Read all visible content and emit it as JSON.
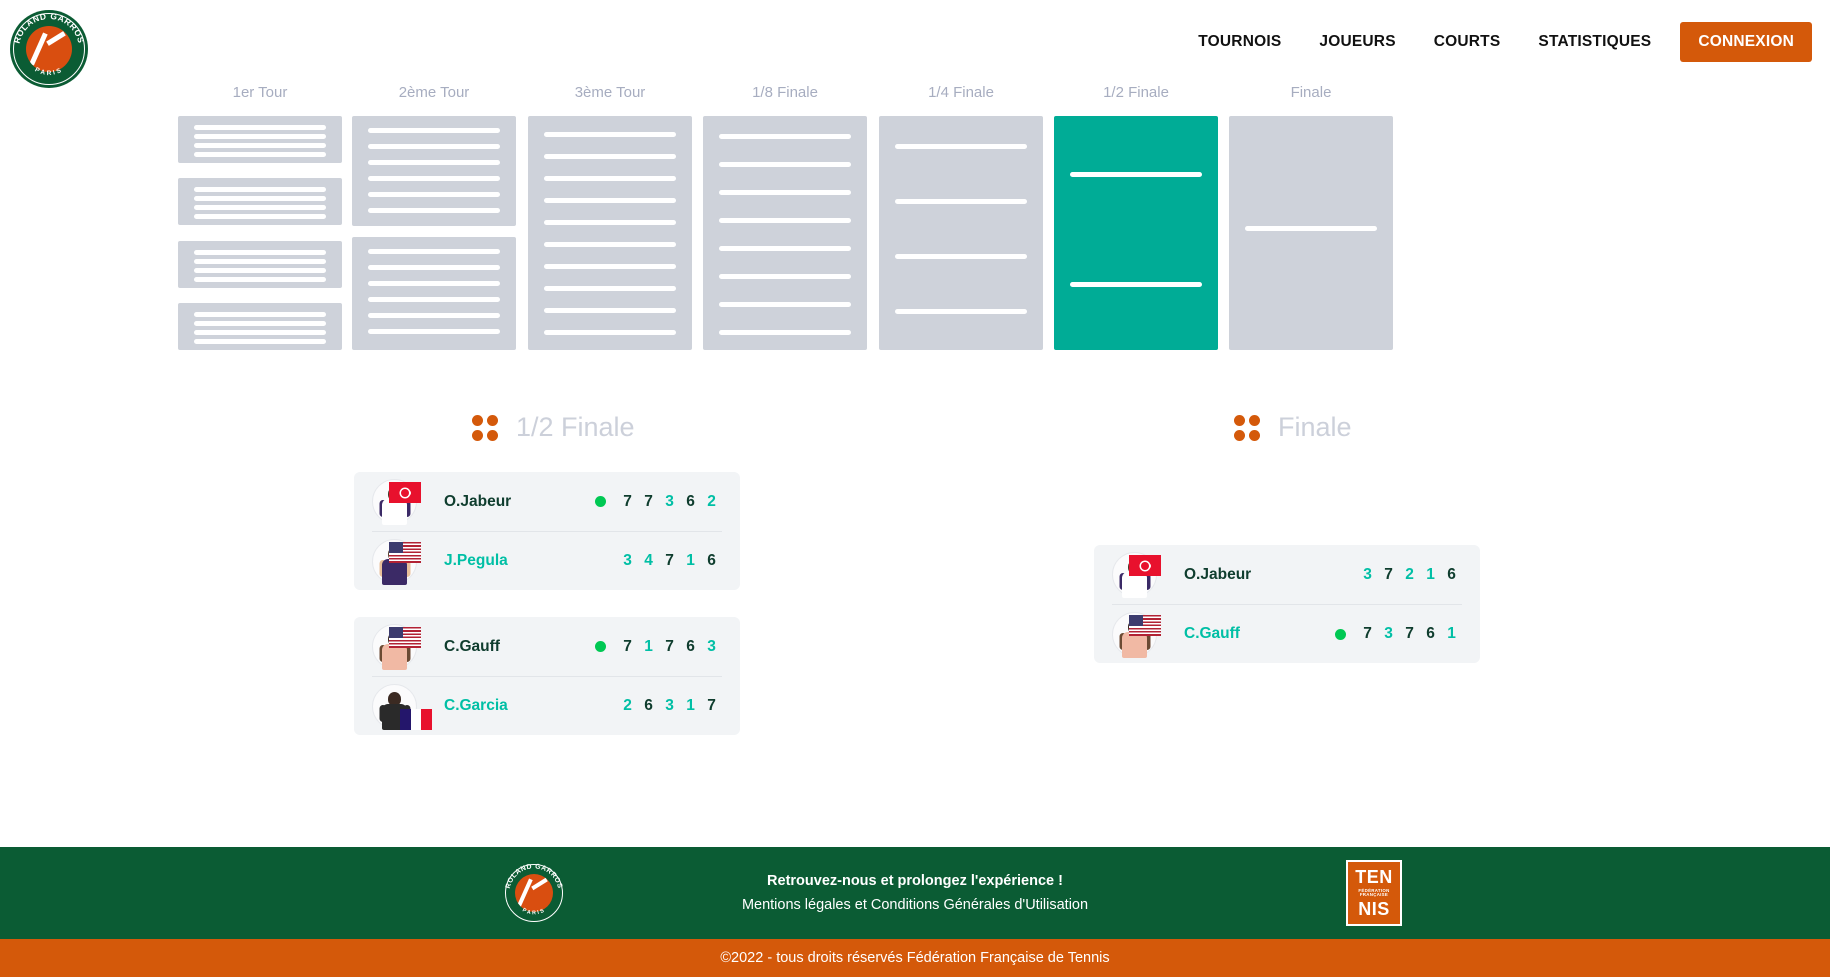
{
  "header": {
    "logo_alt": "Roland Garros Paris",
    "nav": [
      {
        "label": "TOURNOIS"
      },
      {
        "label": "JOUEURS"
      },
      {
        "label": "COURTS"
      },
      {
        "label": "STATISTIQUES"
      }
    ],
    "login_label": "CONNEXION"
  },
  "bracket": {
    "columns": [
      {
        "label": "1er Tour",
        "active": false
      },
      {
        "label": "2ème Tour",
        "active": false
      },
      {
        "label": "3ème Tour",
        "active": false
      },
      {
        "label": "1/8 Finale",
        "active": false
      },
      {
        "label": "1/4 Finale",
        "active": false
      },
      {
        "label": "1/2 Finale",
        "active": true
      },
      {
        "label": "Finale",
        "active": false
      }
    ]
  },
  "colors": {
    "accent_orange": "#d4590a",
    "green_dark": "#0b5c34",
    "teal_active": "#00ac96",
    "score_low": "#00bfa5",
    "score_high": "#0f3d2e",
    "win_dot": "#00c853",
    "skeleton_grey": "#ced2da",
    "card_bg": "#f2f4f6"
  },
  "sections": [
    {
      "title": "1/2 Finale",
      "icon": "four-dots-icon",
      "matches": [
        {
          "players": [
            {
              "name": "O.Jabeur",
              "flag": "tn",
              "winner": true,
              "outfit": {
                "head": "#e8bf9a",
                "shirt": "#ffffff",
                "arm": "#3b2a66"
              },
              "scores": [
                {
                  "value": "7",
                  "high": true
                },
                {
                  "value": "7",
                  "high": true
                },
                {
                  "value": "3",
                  "high": false
                },
                {
                  "value": "6",
                  "high": true
                },
                {
                  "value": "2",
                  "high": false
                }
              ]
            },
            {
              "name": "J.Pegula",
              "flag": "us",
              "winner": false,
              "outfit": {
                "head": "#e8bf9a",
                "shirt": "#3b2a66",
                "arm": "#e8bf9a"
              },
              "scores": [
                {
                  "value": "3",
                  "high": false
                },
                {
                  "value": "4",
                  "high": false
                },
                {
                  "value": "7",
                  "high": true
                },
                {
                  "value": "1",
                  "high": false
                },
                {
                  "value": "6",
                  "high": true
                }
              ]
            }
          ]
        },
        {
          "players": [
            {
              "name": "C.Gauff",
              "flag": "us",
              "winner": true,
              "outfit": {
                "head": "#6b4a33",
                "shirt": "#f1b9a4",
                "arm": "#6b4a33"
              },
              "scores": [
                {
                  "value": "7",
                  "high": true
                },
                {
                  "value": "1",
                  "high": false
                },
                {
                  "value": "7",
                  "high": true
                },
                {
                  "value": "6",
                  "high": true
                },
                {
                  "value": "3",
                  "high": false
                }
              ]
            },
            {
              "name": "C.Garcia",
              "flag": "fr",
              "winner": false,
              "outfit": {
                "head": "#3b2a22",
                "shirt": "#2a2a2a",
                "arm": "#2a2a2a"
              },
              "scores": [
                {
                  "value": "2",
                  "high": false
                },
                {
                  "value": "6",
                  "high": true
                },
                {
                  "value": "3",
                  "high": false
                },
                {
                  "value": "1",
                  "high": false
                },
                {
                  "value": "7",
                  "high": true
                }
              ]
            }
          ]
        }
      ]
    },
    {
      "title": "Finale",
      "icon": "four-dots-icon",
      "matches": [
        {
          "players": [
            {
              "name": "O.Jabeur",
              "flag": "tn",
              "winner": false,
              "outfit": {
                "head": "#e8bf9a",
                "shirt": "#ffffff",
                "arm": "#3b2a66"
              },
              "scores": [
                {
                  "value": "3",
                  "high": false
                },
                {
                  "value": "7",
                  "high": true
                },
                {
                  "value": "2",
                  "high": false
                },
                {
                  "value": "1",
                  "high": false
                },
                {
                  "value": "6",
                  "high": true
                }
              ]
            },
            {
              "name": "C.Gauff",
              "flag": "us",
              "winner": true,
              "outfit": {
                "head": "#6b4a33",
                "shirt": "#f1b9a4",
                "arm": "#6b4a33"
              },
              "scores": [
                {
                  "value": "7",
                  "high": true
                },
                {
                  "value": "3",
                  "high": false
                },
                {
                  "value": "7",
                  "high": true
                },
                {
                  "value": "6",
                  "high": true
                },
                {
                  "value": "1",
                  "high": false
                }
              ]
            }
          ]
        }
      ]
    }
  ],
  "footer": {
    "tagline": "Retrouvez-nous et prolongez l'expérience !",
    "legal_link": "Mentions légales et Conditions Générales d'Utilisation",
    "fft_logo": {
      "top": "TEN",
      "mid": "FÉDÉRATION FRANÇAISE",
      "bottom": "NIS"
    },
    "copyright": "©2022 - tous droits réservés Fédération Française de Tennis"
  }
}
